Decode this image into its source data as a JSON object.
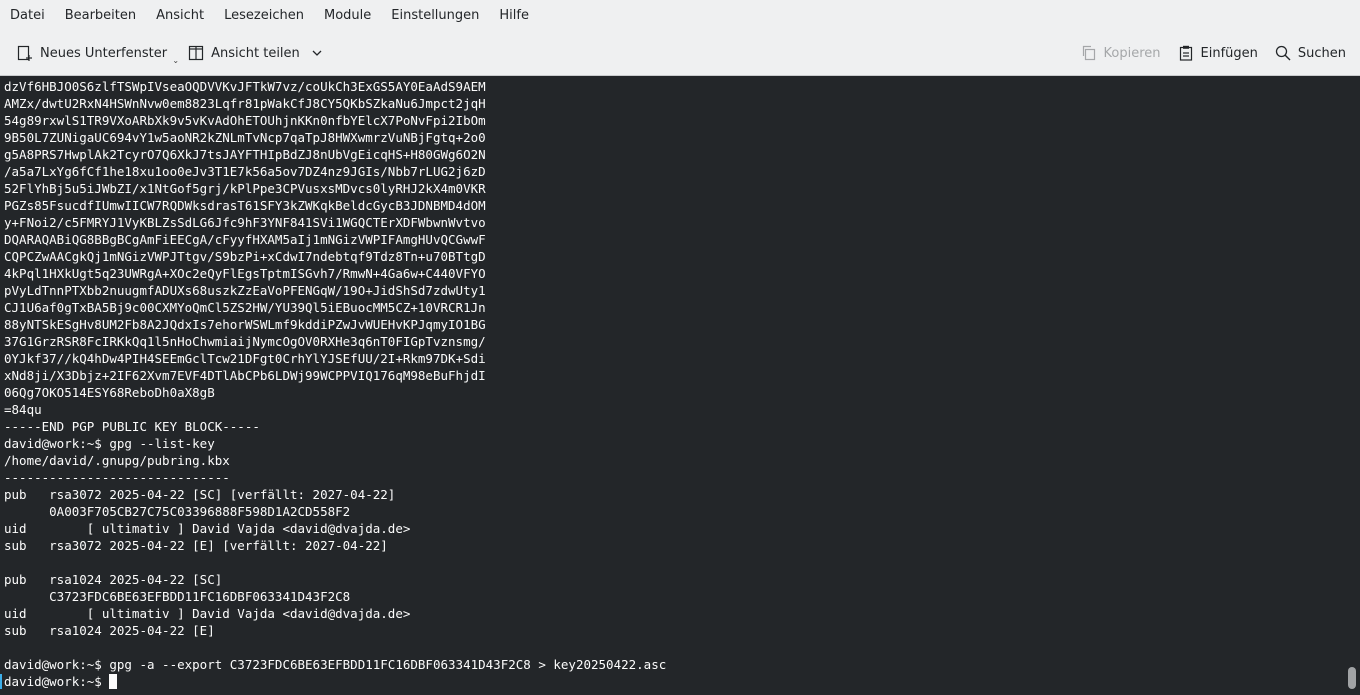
{
  "menubar": {
    "items": [
      "Datei",
      "Bearbeiten",
      "Ansicht",
      "Lesezeichen",
      "Module",
      "Einstellungen",
      "Hilfe"
    ]
  },
  "toolbar": {
    "new_tab_label": "Neues Unterfenster",
    "split_view_label": "Ansicht teilen",
    "copy_label": "Kopieren",
    "paste_label": "Einfügen",
    "search_label": "Suchen"
  },
  "terminal": {
    "lines": [
      "dzVf6HBJO0S6zlfTSWpIVseaOQDVVKvJFTkW7vz/coUkCh3ExGS5AY0EaAdS9AEM",
      "AMZx/dwtU2RxN4HSWnNvw0em8823Lqfr81pWakCfJ8CY5QKbSZkaNu6Jmpct2jqH",
      "54g89rxwlS1TR9VXoARbXk9v5vKvAdOhETOUhjnKKn0nfbYElcX7PoNvFpi2IbOm",
      "9B50L7ZUNigaUC694vY1w5aoNR2kZNLmTvNcp7qaTpJ8HWXwmrzVuNBjFgtq+2o0",
      "g5A8PRS7HwplAk2TcyrO7Q6XkJ7tsJAYFTHIpBdZJ8nUbVgEicqHS+H80GWg6O2N",
      "/a5a7LxYg6fCf1he18xu1oo0eJv3T1E7k56a5ov7DZ4nz9JGIs/Nbb7rLUG2j6zD",
      "52FlYhBj5u5iJWbZI/x1NtGof5grj/kPlPpe3CPVusxsMDvcs0lyRHJ2kX4m0VKR",
      "PGZs85FsucdfIUmwIICW7RQDWksdrasT61SFY3kZWKqkBeldcGycB3JDNBMD4dOM",
      "y+FNoi2/c5FMRYJ1VyKBLZsSdLG6Jfc9hF3YNF841SVi1WGQCTErXDFWbwnWvtvo",
      "DQARAQABiQG8BBgBCgAmFiEECgA/cFyyfHXAM5aIj1mNGizVWPIFAmgHUvQCGwwF",
      "CQPCZwAACgkQj1mNGizVWPJTtgv/S9bzPi+xCdwI7ndebtqf9Tdz8Tn+u70BTtgD",
      "4kPql1HXkUgt5q23UWRgA+XOc2eQyFlEgsTptmISGvh7/RmwN+4Ga6w+C440VFYO",
      "pVyLdTnnPTXbb2nuugmfADUXs68uszkZzEaVoPFENGqW/19O+JidShSd7zdwUty1",
      "CJ1U6af0gTxBA5Bj9c00CXMYoQmCl5ZS2HW/YU39Ql5iEBuocMM5CZ+10VRCR1Jn",
      "88yNTSkESgHv8UM2Fb8A2JQdxIs7ehorWSWLmf9kddiPZwJvWUEHvKPJqmyIO1BG",
      "37G1GrzRSR8FcIRKkQq1l5nHoChwmiaijNymcOgOV0RXHe3q6nT0FIGpTvznsmg/",
      "0YJkf37//kQ4hDw4PIH4SEEmGclTcw21DFgt0CrhYlYJSEfUU/2I+Rkm97DK+Sdi",
      "xNd8ji/X3Dbjz+2IF62Xvm7EVF4DTlAbCPb6LDWj99WCPPVIQ176qM98eBuFhjdI",
      "06Qg7OKO514ESY68ReboDh0aX8gB",
      "=84qu",
      "-----END PGP PUBLIC KEY BLOCK-----",
      "david@work:~$ gpg --list-key",
      "/home/david/.gnupg/pubring.kbx",
      "------------------------------",
      "pub   rsa3072 2025-04-22 [SC] [verfällt: 2027-04-22]",
      "      0A003F705CB27C75C03396888F598D1A2CD558F2",
      "uid        [ ultimativ ] David Vajda <david@dvajda.de>",
      "sub   rsa3072 2025-04-22 [E] [verfällt: 2027-04-22]",
      "",
      "pub   rsa1024 2025-04-22 [SC]",
      "      C3723FDC6BE63EFBDD11FC16DBF063341D43F2C8",
      "uid        [ ultimativ ] David Vajda <david@dvajda.de>",
      "sub   rsa1024 2025-04-22 [E]",
      "",
      "david@work:~$ gpg -a --export C3723FDC6BE63EFBDD11FC16DBF063341D43F2C8 > key20250422.asc"
    ],
    "prompt": "david@work:~$ "
  },
  "colors": {
    "terminal_bg": "#232629",
    "terminal_fg": "#fcfcfc",
    "chrome_bg": "#eff0f1",
    "accent": "#3daee9"
  }
}
